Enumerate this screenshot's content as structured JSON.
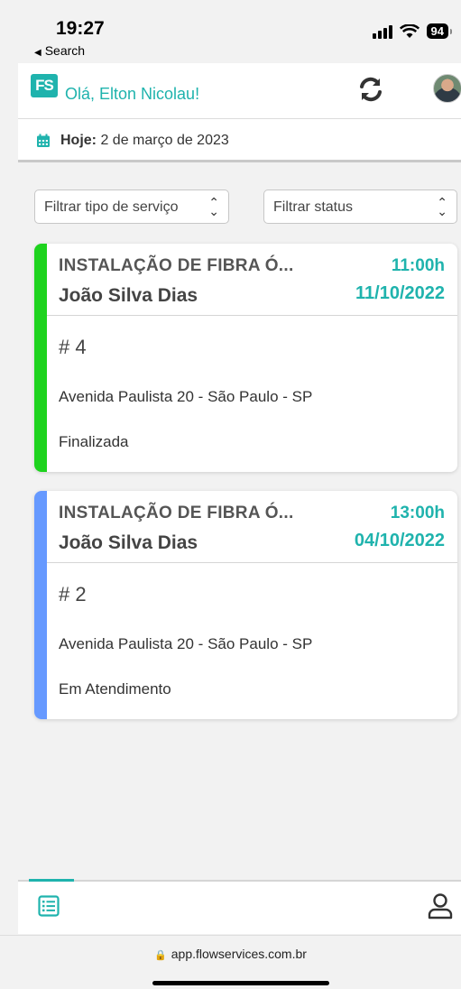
{
  "status_bar": {
    "time": "19:27",
    "back_label": "Search",
    "battery": "94"
  },
  "header": {
    "logo_text": "FS",
    "greeting": "Olá, Elton Nicolau!",
    "refresh_icon": "refresh-icon",
    "avatar_icon": "user-avatar"
  },
  "date_bar": {
    "label": "Hoje:",
    "value": "2 de março de 2023"
  },
  "filters": {
    "service_type_placeholder": "Filtrar tipo de serviço",
    "status_placeholder": "Filtrar status"
  },
  "orders": [
    {
      "title": "INSTALAÇÃO DE FIBRA Ó...",
      "customer": "João Silva Dias",
      "time": "11:00h",
      "date": "11/10/2022",
      "number": "# 4",
      "address": "Avenida Paulista 20 - São Paulo - SP",
      "status": "Finalizada",
      "status_color": "#1ed31e"
    },
    {
      "title": "INSTALAÇÃO DE FIBRA Ó...",
      "customer": "João Silva Dias",
      "time": "13:00h",
      "date": "04/10/2022",
      "number": "# 2",
      "address": "Avenida Paulista 20 - São Paulo - SP",
      "status": "Em Atendimento",
      "status_color": "#6699ff"
    }
  ],
  "bottom_nav": {
    "items": [
      "list-icon",
      "user-icon"
    ]
  },
  "browser": {
    "url": "app.flowservices.com.br"
  },
  "colors": {
    "accent": "#1fb3ad",
    "finalizada": "#1ed31e",
    "em_atendimento": "#6699ff"
  }
}
